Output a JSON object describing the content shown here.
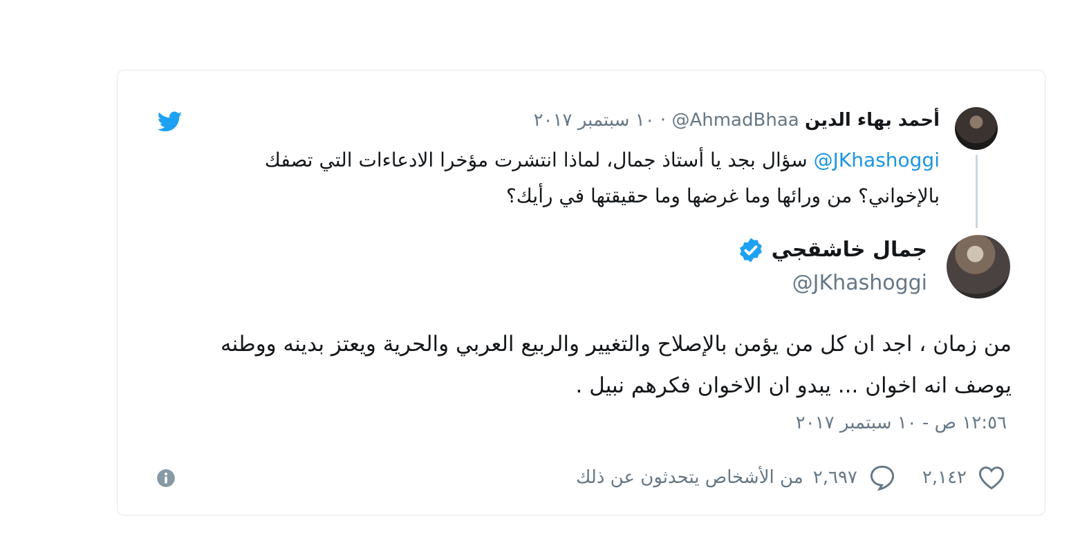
{
  "parent_tweet": {
    "author_name": "أحمد بهاء الدين",
    "author_handle": "@AhmadBhaa",
    "date": "· ١٠ سبتمبر ٢٠١٧",
    "mention": "@JKhashoggi",
    "text_part1": "سؤال بجد يا أستاذ جمال، لماذا انتشرت مؤخرا الادعاءات التي تصفك بالإخواني؟ من ورائها وما غرضها وما حقيقتها في رأيك؟"
  },
  "main_tweet": {
    "author_name": "جمال خاشقجي",
    "author_handle": "@JKhashoggi",
    "verified": true,
    "text": "من زمان ، اجد ان كل من يؤمن بالإصلاح والتغيير والربيع العربي والحرية ويعتز بدينه ووطنه يوصف انه اخوان ... يبدو ان الاخوان فكرهم نبيل .",
    "timestamp": "١٢:٥٦ ص - ١٠ سبتمبر ٢٠١٧",
    "likes": "٢,١٤٢",
    "talking_count": "٢,٦٩٧",
    "talking_label": "من الأشخاص يتحدثون عن ذلك"
  },
  "icons": {
    "brand": "twitter-bird-icon",
    "like": "heart-icon",
    "reply": "speech-bubble-icon",
    "info": "info-icon",
    "verified": "verified-badge-icon"
  },
  "colors": {
    "twitter_blue": "#1da1f2",
    "mention_blue": "#1b95e0",
    "secondary_text": "#657786",
    "border": "#e1e8ed"
  }
}
